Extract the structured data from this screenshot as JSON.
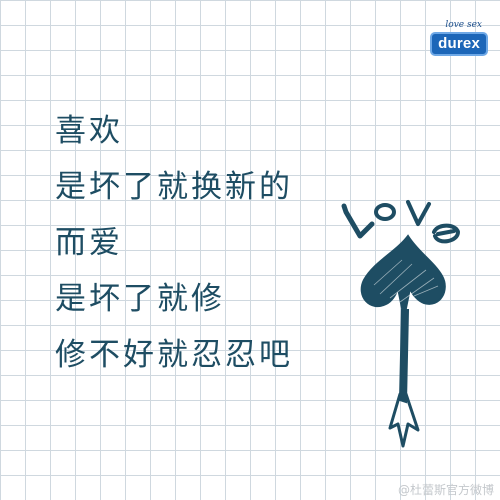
{
  "brand": {
    "tagline": "love sex",
    "logo_text": "durex",
    "color": "#1c66b8"
  },
  "poem": {
    "lines": [
      "喜欢",
      "是坏了就换新的",
      "而爱",
      "是坏了就修",
      "修不好就忍忍吧"
    ]
  },
  "drawing": {
    "word": "LOVE",
    "ink_color": "#1e4d63"
  },
  "watermark": {
    "text": "@杜蕾斯官方微博"
  }
}
